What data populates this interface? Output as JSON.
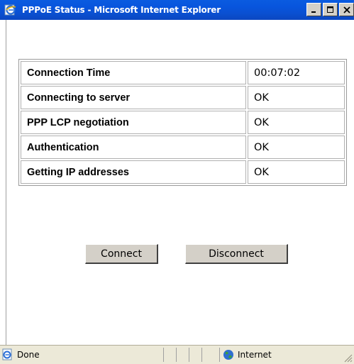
{
  "window": {
    "title": "PPPoE Status - Microsoft Internet Explorer",
    "controls": [
      "minimize",
      "maximize",
      "close"
    ]
  },
  "status": {
    "rows": [
      {
        "label": "Connection Time",
        "value": "00:07:02"
      },
      {
        "label": "Connecting to server",
        "value": "OK"
      },
      {
        "label": "PPP LCP negotiation",
        "value": "OK"
      },
      {
        "label": "Authentication",
        "value": "OK"
      },
      {
        "label": "Getting IP addresses",
        "value": "OK"
      }
    ]
  },
  "actions": {
    "connect_label": "Connect",
    "disconnect_label": "Disconnect"
  },
  "statusbar": {
    "text": "Done",
    "zone": "Internet"
  },
  "icons": {
    "title": "ie-icon",
    "status": "ie-page-icon",
    "zone": "globe-icon"
  },
  "colors": {
    "titlebar": "#0a5be0",
    "button_face": "#d4d0c8",
    "statusbar": "#ece9d8"
  }
}
